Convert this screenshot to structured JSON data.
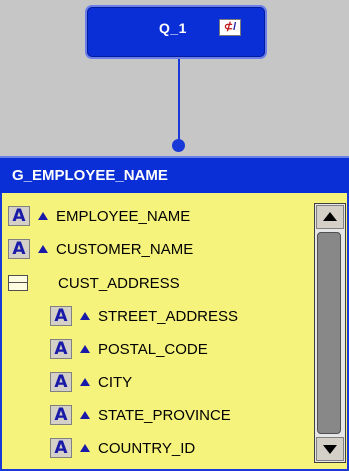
{
  "query": {
    "title": "Q_1",
    "sql_icon": "sql-query-icon",
    "accent_color": "#0a2fd6"
  },
  "group": {
    "title": "G_EMPLOYEE_NAME",
    "body_color": "#f6f37c",
    "items": [
      {
        "label": "EMPLOYEE_NAME",
        "icon": "alpha-field-icon",
        "indent": 0
      },
      {
        "label": "CUSTOMER_NAME",
        "icon": "alpha-field-icon",
        "indent": 0
      },
      {
        "label": "CUST_ADDRESS",
        "icon": "object-group-icon",
        "indent": 0
      },
      {
        "label": "STREET_ADDRESS",
        "icon": "alpha-field-icon",
        "indent": 1
      },
      {
        "label": "POSTAL_CODE",
        "icon": "alpha-field-icon",
        "indent": 1
      },
      {
        "label": "CITY",
        "icon": "alpha-field-icon",
        "indent": 1
      },
      {
        "label": "STATE_PROVINCE",
        "icon": "alpha-field-icon",
        "indent": 1
      },
      {
        "label": "COUNTRY_ID",
        "icon": "alpha-field-icon",
        "indent": 1
      }
    ]
  }
}
